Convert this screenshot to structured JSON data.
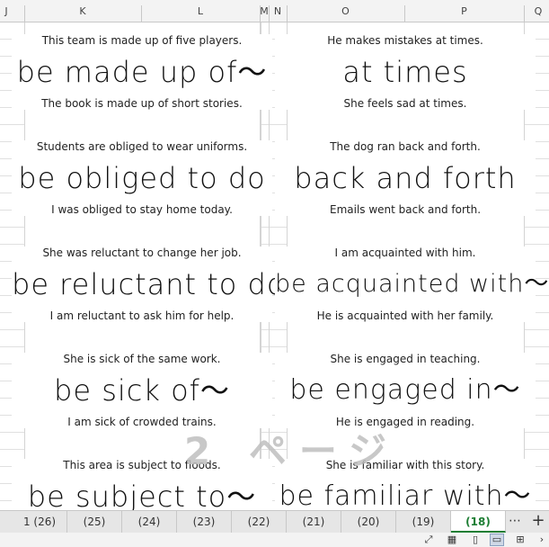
{
  "columns": [
    "J",
    "K",
    "L",
    "M",
    "N",
    "O",
    "P",
    "Q"
  ],
  "cards": [
    {
      "top": "This team is made up of five players.",
      "phrase": "be made up of〜",
      "bottom": "The book is made up of short stories."
    },
    {
      "top": "He makes mistakes at times.",
      "phrase": "at times",
      "bottom": "She feels sad at times."
    },
    {
      "top": "Students are obliged to wear uniforms.",
      "phrase": "be obliged to do",
      "bottom": "I was obliged to stay home today."
    },
    {
      "top": "The dog ran back and forth.",
      "phrase": "back and forth",
      "bottom": "Emails went back and forth."
    },
    {
      "top": "She was reluctant to change her job.",
      "phrase": "be reluctant to do",
      "bottom": "I am reluctant to ask him for help."
    },
    {
      "top": "I am acquainted with him.",
      "phrase": "be acquainted with〜",
      "bottom": "He is acquainted with her family."
    },
    {
      "top": "She is sick of the same work.",
      "phrase": "be sick of〜",
      "bottom": "I am sick of crowded trains."
    },
    {
      "top": "She is engaged in teaching.",
      "phrase": "be engaged in〜",
      "bottom": "He is engaged in reading."
    },
    {
      "top": "This area is subject to floods.",
      "phrase": "be subject to〜",
      "bottom": ""
    },
    {
      "top": "She is familiar with this story.",
      "phrase": "be familiar with〜",
      "bottom": ""
    }
  ],
  "watermark": "2 ページ",
  "sheet_tabs": [
    "1 (26)",
    "(25)",
    "(24)",
    "(23)",
    "(22)",
    "(21)",
    "(20)",
    "(19)",
    "(18)"
  ],
  "active_tab": "(18)",
  "more_label": "⋯",
  "add_label": "+",
  "accent": "#1e7e34"
}
